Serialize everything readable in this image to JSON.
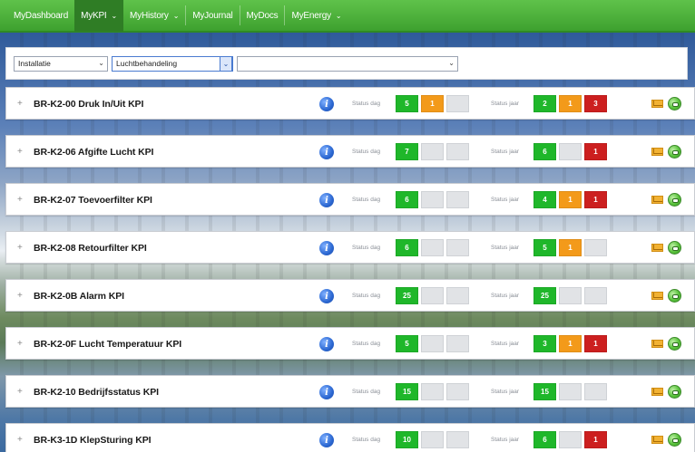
{
  "nav": {
    "items": [
      {
        "label": "MyDashboard",
        "active": false,
        "has_caret": false
      },
      {
        "label": "MyKPI",
        "active": true,
        "has_caret": true
      },
      {
        "label": "MyHistory",
        "active": false,
        "has_caret": true
      },
      {
        "label": "MyJournal",
        "active": false,
        "has_caret": false
      },
      {
        "label": "MyDocs",
        "active": false,
        "has_caret": false
      },
      {
        "label": "MyEnergy",
        "active": false,
        "has_caret": true
      }
    ],
    "caret": "⌄"
  },
  "filters": {
    "installation": "Installatie",
    "category": "Luchtbehandeling",
    "third": ""
  },
  "status_day_label": "Status dag",
  "status_year_label": "Status jaar",
  "colors": {
    "green": "#1fb72a",
    "orange": "#f39a1a",
    "red": "#cc1f1f",
    "empty": "#e1e3e6",
    "nav": "#3ea12f"
  },
  "rows": [
    {
      "title": "BR-K2-00 Druk In/Uit KPI",
      "day": [
        {
          "color": "green",
          "value": "5"
        },
        {
          "color": "orange",
          "value": "1"
        },
        {
          "color": "empty",
          "value": ""
        }
      ],
      "year": [
        {
          "color": "green",
          "value": "2"
        },
        {
          "color": "orange",
          "value": "1"
        },
        {
          "color": "red",
          "value": "3"
        }
      ]
    },
    {
      "title": "BR-K2-06 Afgifte Lucht KPI",
      "day": [
        {
          "color": "green",
          "value": "7"
        },
        {
          "color": "empty",
          "value": ""
        },
        {
          "color": "empty",
          "value": ""
        }
      ],
      "year": [
        {
          "color": "green",
          "value": "6"
        },
        {
          "color": "empty",
          "value": ""
        },
        {
          "color": "red",
          "value": "1"
        }
      ]
    },
    {
      "title": "BR-K2-07 Toevoerfilter KPI",
      "day": [
        {
          "color": "green",
          "value": "6"
        },
        {
          "color": "empty",
          "value": ""
        },
        {
          "color": "empty",
          "value": ""
        }
      ],
      "year": [
        {
          "color": "green",
          "value": "4"
        },
        {
          "color": "orange",
          "value": "1"
        },
        {
          "color": "red",
          "value": "1"
        }
      ]
    },
    {
      "title": "BR-K2-08 Retourfilter KPI",
      "day": [
        {
          "color": "green",
          "value": "6"
        },
        {
          "color": "empty",
          "value": ""
        },
        {
          "color": "empty",
          "value": ""
        }
      ],
      "year": [
        {
          "color": "green",
          "value": "5"
        },
        {
          "color": "orange",
          "value": "1"
        },
        {
          "color": "empty",
          "value": ""
        }
      ]
    },
    {
      "title": "BR-K2-0B Alarm KPI",
      "day": [
        {
          "color": "green",
          "value": "25"
        },
        {
          "color": "empty",
          "value": ""
        },
        {
          "color": "empty",
          "value": ""
        }
      ],
      "year": [
        {
          "color": "green",
          "value": "25"
        },
        {
          "color": "empty",
          "value": ""
        },
        {
          "color": "empty",
          "value": ""
        }
      ]
    },
    {
      "title": "BR-K2-0F Lucht Temperatuur KPI",
      "day": [
        {
          "color": "green",
          "value": "5"
        },
        {
          "color": "empty",
          "value": ""
        },
        {
          "color": "empty",
          "value": ""
        }
      ],
      "year": [
        {
          "color": "green",
          "value": "3"
        },
        {
          "color": "orange",
          "value": "1"
        },
        {
          "color": "red",
          "value": "1"
        }
      ]
    },
    {
      "title": "BR-K2-10 Bedrijfsstatus KPI",
      "day": [
        {
          "color": "green",
          "value": "15"
        },
        {
          "color": "empty",
          "value": ""
        },
        {
          "color": "empty",
          "value": ""
        }
      ],
      "year": [
        {
          "color": "green",
          "value": "15"
        },
        {
          "color": "empty",
          "value": ""
        },
        {
          "color": "empty",
          "value": ""
        }
      ]
    },
    {
      "title": "BR-K3-1D KlepSturing KPI",
      "day": [
        {
          "color": "green",
          "value": "10"
        },
        {
          "color": "empty",
          "value": ""
        },
        {
          "color": "empty",
          "value": ""
        }
      ],
      "year": [
        {
          "color": "green",
          "value": "6"
        },
        {
          "color": "empty",
          "value": ""
        },
        {
          "color": "red",
          "value": "1"
        }
      ]
    }
  ]
}
